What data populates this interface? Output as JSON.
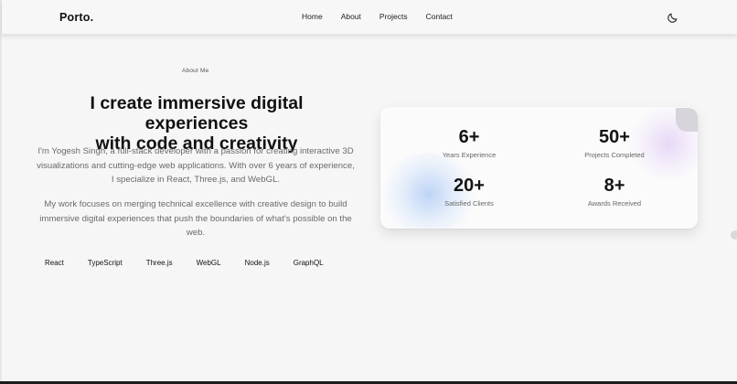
{
  "brand": {
    "logo": "Porto."
  },
  "nav": {
    "links": [
      {
        "label": "Home"
      },
      {
        "label": "About"
      },
      {
        "label": "Projects"
      },
      {
        "label": "Contact"
      }
    ],
    "theme_toggle_icon": "moon-icon"
  },
  "about": {
    "tag": "About Me",
    "headline_line1": "I create immersive digital experiences",
    "headline_line2": "with code and creativity",
    "paragraph1": "I'm Yogesh Singh, a full-stack developer with a passion for creating interactive 3D visualizations and cutting-edge web applications. With over 6 years of experience, I specialize in React, Three.js, and WebGL.",
    "paragraph2": "My work focuses on merging technical excellence with creative design to build immersive digital experiences that push the boundaries of what's possible on the web.",
    "skills": [
      "React",
      "TypeScript",
      "Three.js",
      "WebGL",
      "Node.js",
      "GraphQL"
    ]
  },
  "stats": [
    {
      "value": "6+",
      "label": "Years Experience"
    },
    {
      "value": "50+",
      "label": "Projects Completed"
    },
    {
      "value": "20+",
      "label": "Satisfied Clients"
    },
    {
      "value": "8+",
      "label": "Awards Received"
    }
  ],
  "colors": {
    "background": "#f6f6f6",
    "text": "#111111",
    "muted_text": "#6a6a6a",
    "card_glow_blue": "#aac8f5",
    "card_glow_purple": "#e1cdf5"
  }
}
